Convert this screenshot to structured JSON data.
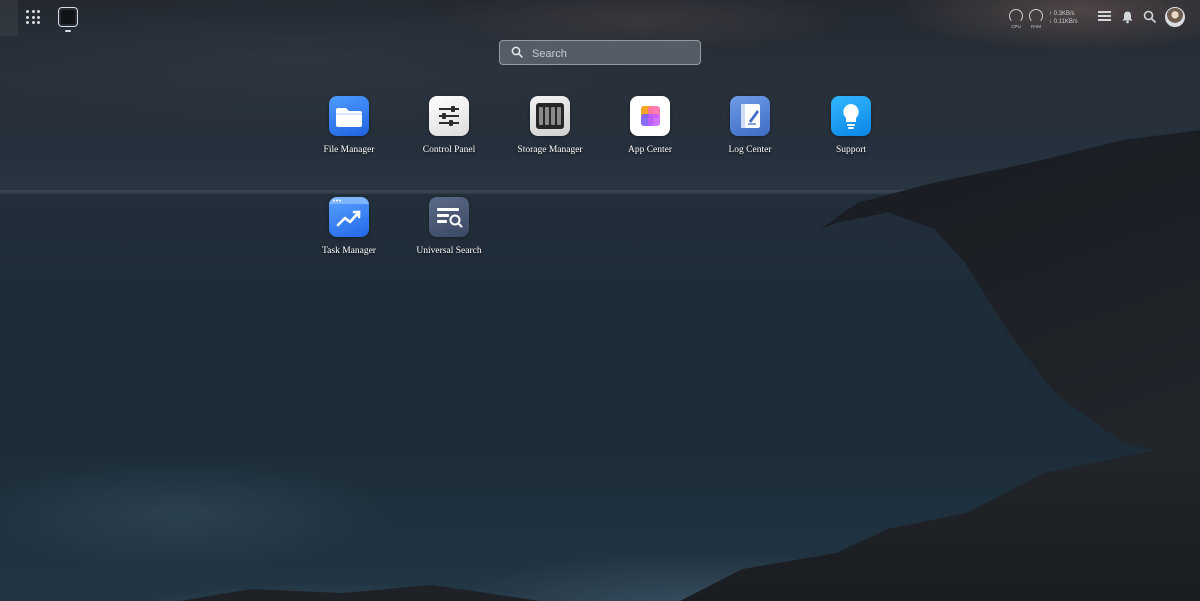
{
  "topbar": {
    "cpu_label": "CPU",
    "ram_label": "RAM",
    "upload_rate": "↑ 0.3KB/s",
    "download_rate": "↓ 0.11KB/s",
    "icons": [
      "app-grid-icon",
      "window-icon",
      "cpu-gauge-icon",
      "ram-gauge-icon",
      "storage-stack-icon",
      "bell-icon",
      "search-icon",
      "user-avatar"
    ]
  },
  "search": {
    "placeholder": "Search"
  },
  "apps": [
    {
      "label": "File Manager",
      "icon": "folder-icon",
      "color": "#2f7bf5"
    },
    {
      "label": "Control Panel",
      "icon": "sliders-icon",
      "color": "#f2f2f2"
    },
    {
      "label": "Storage Manager",
      "icon": "disk-bays-icon",
      "color": "#3a3a3a"
    },
    {
      "label": "App Center",
      "icon": "app-center-icon",
      "color": "#ffffff"
    },
    {
      "label": "Log Center",
      "icon": "log-book-icon",
      "color": "#5a86d6"
    },
    {
      "label": "Support",
      "icon": "lightbulb-icon",
      "color": "#1aa0f5"
    },
    {
      "label": "Task Manager",
      "icon": "trend-chart-icon",
      "color": "#3b8af5"
    },
    {
      "label": "Universal Search",
      "icon": "doc-search-icon",
      "color": "#4b5a77"
    }
  ]
}
